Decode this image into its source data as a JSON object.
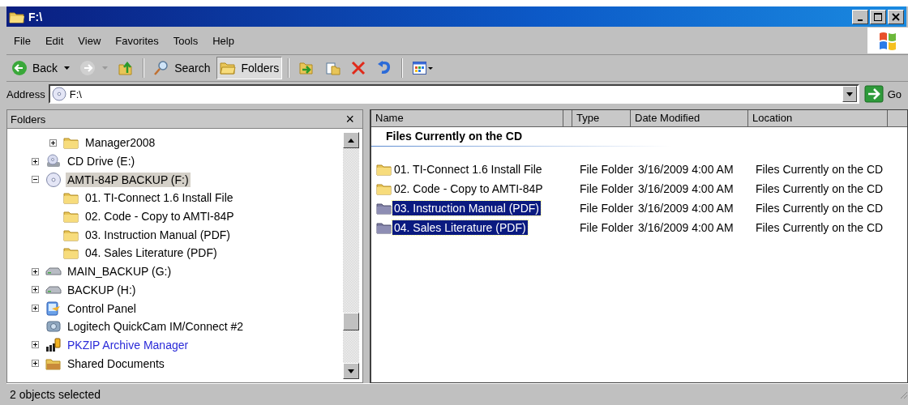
{
  "window": {
    "title": "F:\\"
  },
  "menu": [
    "File",
    "Edit",
    "View",
    "Favorites",
    "Tools",
    "Help"
  ],
  "toolbar": [
    {
      "kind": "back",
      "label": "Back"
    },
    {
      "kind": "forward",
      "disabled": true
    },
    {
      "kind": "up"
    },
    {
      "kind": "search",
      "label": "Search",
      "selected": false
    },
    {
      "kind": "folders",
      "label": "Folders",
      "selected": true
    },
    {
      "kind": "move"
    },
    {
      "kind": "copy"
    },
    {
      "kind": "delete"
    },
    {
      "kind": "undo"
    },
    {
      "kind": "views"
    }
  ],
  "address": {
    "label": "Address",
    "value": "F:\\",
    "go": "Go"
  },
  "folders_pane": {
    "title": "Folders",
    "close": "×",
    "tree": [
      {
        "children": [
          {
            "label": "Manager2008",
            "kind": "folder",
            "expanded": false,
            "selected": false,
            "compressed": false
          }
        ]
      },
      {
        "label": "CD Drive (E:)",
        "kind": "cd-drive",
        "expanded": false,
        "selected": false,
        "compressed": false
      },
      {
        "label": "AMTI-84P BACKUP (F:)",
        "kind": "disc",
        "expanded": true,
        "selected": true,
        "compressed": false,
        "children": [
          {
            "label": "01.  TI-Connect 1.6 Install File",
            "kind": "folder",
            "selected": false,
            "compressed": false
          },
          {
            "label": "02.  Code - Copy to AMTI-84P",
            "kind": "folder",
            "selected": false,
            "compressed": false
          },
          {
            "label": "03.  Instruction Manual (PDF)",
            "kind": "folder",
            "selected": false,
            "compressed": false
          },
          {
            "label": "04.  Sales Literature (PDF)",
            "kind": "folder",
            "selected": false,
            "compressed": false
          }
        ]
      },
      {
        "label": "MAIN_BACKUP (G:)",
        "kind": "hard-drive",
        "expanded": false,
        "selected": false,
        "compressed": false
      },
      {
        "label": "BACKUP (H:)",
        "kind": "hard-drive",
        "expanded": false,
        "selected": false,
        "compressed": false
      },
      {
        "label": "Control Panel",
        "kind": "control-panel",
        "expanded": false,
        "selected": false,
        "compressed": false
      },
      {
        "label": "Logitech QuickCam IM/Connect #2",
        "kind": "camera",
        "selected": false,
        "compressed": false
      },
      {
        "label": "PKZIP Archive Manager",
        "kind": "archive",
        "expanded": false,
        "selected": false,
        "compressed": true
      },
      {
        "label": "Shared Documents",
        "kind": "shared-folder",
        "expanded": false,
        "selected": false,
        "compressed": false
      }
    ]
  },
  "file_list": {
    "columns": [
      "Name",
      "",
      "Type",
      "Date Modified",
      "Location"
    ],
    "group": "Files Currently on the CD",
    "rows": [
      {
        "name": "01.  TI-Connect 1.6 Install File",
        "type": "File Folder",
        "date_modified": "3/16/2009 4:00 AM",
        "location": "Files Currently on the CD",
        "selected": false
      },
      {
        "name": "02.  Code - Copy to AMTI-84P",
        "type": "File Folder",
        "date_modified": "3/16/2009 4:00 AM",
        "location": "Files Currently on the CD",
        "selected": false
      },
      {
        "name": "03.  Instruction Manual (PDF)",
        "type": "File Folder",
        "date_modified": "3/16/2009 4:00 AM",
        "location": "Files Currently on the CD",
        "selected": true
      },
      {
        "name": "04.  Sales Literature (PDF)",
        "type": "File Folder",
        "date_modified": "3/16/2009 4:00 AM",
        "location": "Files Currently on the CD",
        "selected": true
      }
    ]
  },
  "status_bar": "2 objects selected"
}
